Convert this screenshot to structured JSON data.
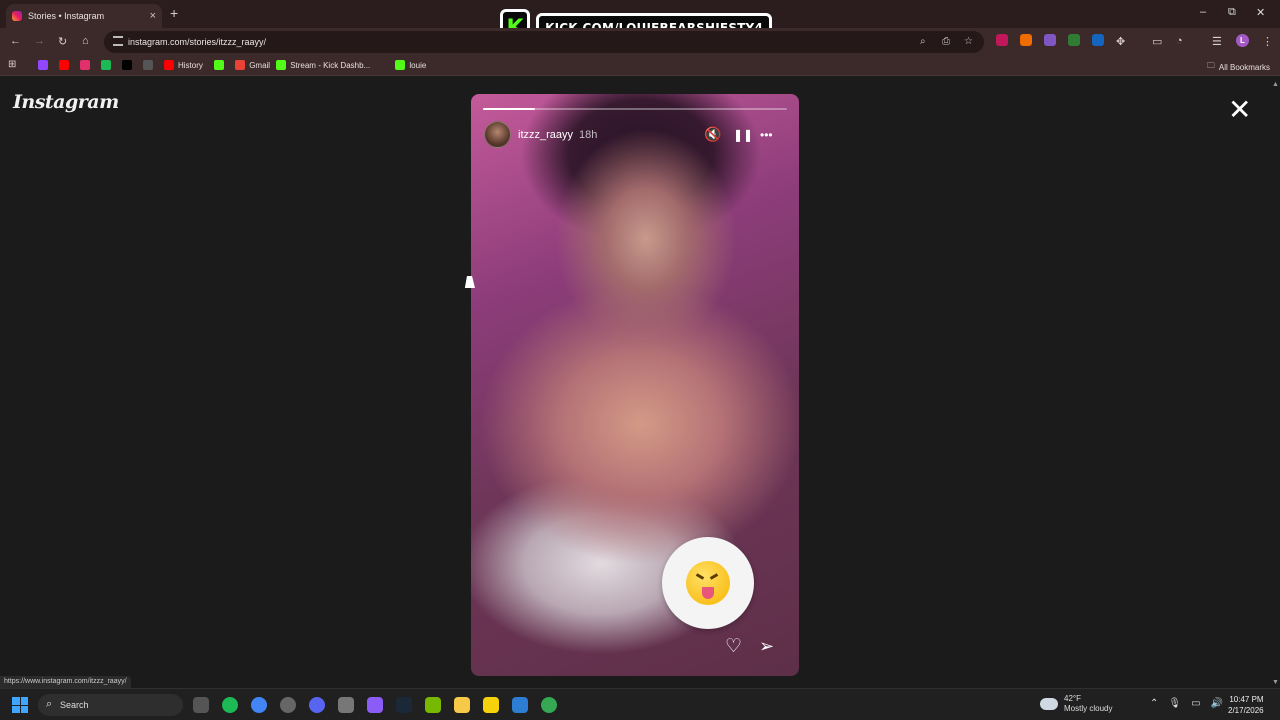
{
  "browser": {
    "tab_title": "Stories • Instagram",
    "tab_close": "×",
    "new_tab": "+",
    "url": "instagram.com/stories/itzzz_raayy/",
    "window_controls": {
      "minimize": "–",
      "maximize": "⧉",
      "close": "✕"
    },
    "bookmarks": [
      {
        "label": "",
        "icon": "twitch-icon",
        "color": "#9146ff"
      },
      {
        "label": "",
        "icon": "youtube-icon",
        "color": "#ff0000"
      },
      {
        "label": "",
        "icon": "instagram-icon",
        "color": "#e1306c"
      },
      {
        "label": "",
        "icon": "spotify-icon",
        "color": "#1db954"
      },
      {
        "label": "",
        "icon": "x-icon",
        "color": "#000000"
      },
      {
        "label": "",
        "icon": "app-icon",
        "color": "#555555"
      },
      {
        "label": "History",
        "icon": "youtube-history-icon",
        "color": "#ff0000"
      },
      {
        "label": "",
        "icon": "kick-icon",
        "color": "#53fc18"
      },
      {
        "label": "Gmail",
        "icon": "gmail-icon",
        "color": "#ea4335"
      },
      {
        "label": "Stream - Kick Dashb...",
        "icon": "kick-icon",
        "color": "#53fc18"
      },
      {
        "label": "louie",
        "icon": "kick-icon",
        "color": "#53fc18"
      }
    ],
    "all_bookmarks": "All Bookmarks",
    "status_url": "https://www.instagram.com/itzzz_raayy/",
    "profile_initial": "L"
  },
  "overlay": {
    "kick_logo": "K",
    "kick_text": "KICK.COM/LOUIEBEARSHIESTY4"
  },
  "page": {
    "logo": "Instagram",
    "close": "✕"
  },
  "story": {
    "username": "itzzz_raayy",
    "time": "18h",
    "progress": 0.17,
    "mute_icon": "🔇",
    "pause_icon": "❚❚",
    "more_icon": "•••",
    "heart_icon": "♡",
    "share_icon": "➢"
  },
  "taskbar": {
    "search_placeholder": "Search",
    "weather_temp": "42°F",
    "weather_desc": "Mostly cloudy",
    "time": "10:47 PM",
    "date": "2/17/2026"
  }
}
